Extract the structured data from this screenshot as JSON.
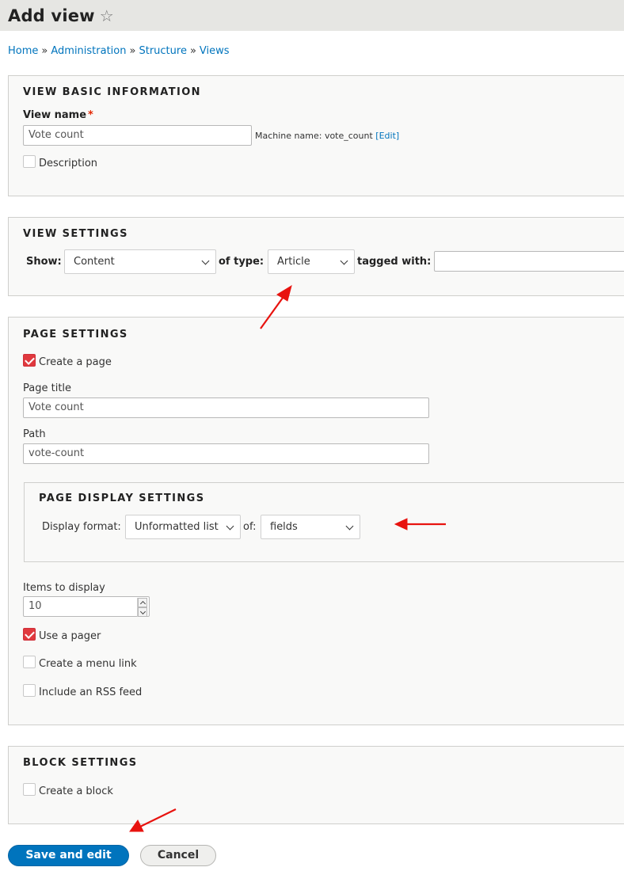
{
  "header": {
    "title": "Add view",
    "star_icon": "☆"
  },
  "breadcrumb": [
    "Home",
    "Administration",
    "Structure",
    "Views"
  ],
  "basic_info": {
    "legend": "VIEW BASIC INFORMATION",
    "view_name_label": "View name",
    "required_mark": "*",
    "view_name_value": "Vote count",
    "machine_name_prefix": "Machine name: vote_count",
    "edit_link": "[Edit]",
    "description_label": "Description",
    "description_checked": false
  },
  "view_settings": {
    "legend": "VIEW SETTINGS",
    "show_label": "Show:",
    "show_value": "Content",
    "type_label": "of type:",
    "type_value": "Article",
    "tagged_label": "tagged with:",
    "tagged_value": ""
  },
  "page_settings": {
    "legend": "PAGE SETTINGS",
    "create_page_label": "Create a page",
    "create_page_checked": true,
    "page_title_label": "Page title",
    "page_title_value": "Vote count",
    "path_label": "Path",
    "path_value": "vote-count",
    "display": {
      "legend": "PAGE DISPLAY SETTINGS",
      "format_label": "Display format:",
      "format_value": "Unformatted list",
      "of_label": "of:",
      "of_value": "fields"
    },
    "items_label": "Items to display",
    "items_value": "10",
    "pager_label": "Use a pager",
    "pager_checked": true,
    "menu_link_label": "Create a menu link",
    "menu_link_checked": false,
    "rss_label": "Include an RSS feed",
    "rss_checked": false
  },
  "block_settings": {
    "legend": "BLOCK SETTINGS",
    "create_block_label": "Create a block",
    "create_block_checked": false
  },
  "actions": {
    "save_label": "Save and edit",
    "cancel_label": "Cancel"
  },
  "colors": {
    "link": "#0074bd",
    "checkbox_checked": "#e0393e",
    "annotation_arrow": "#e8130f",
    "primary_button": "#0074bd"
  }
}
